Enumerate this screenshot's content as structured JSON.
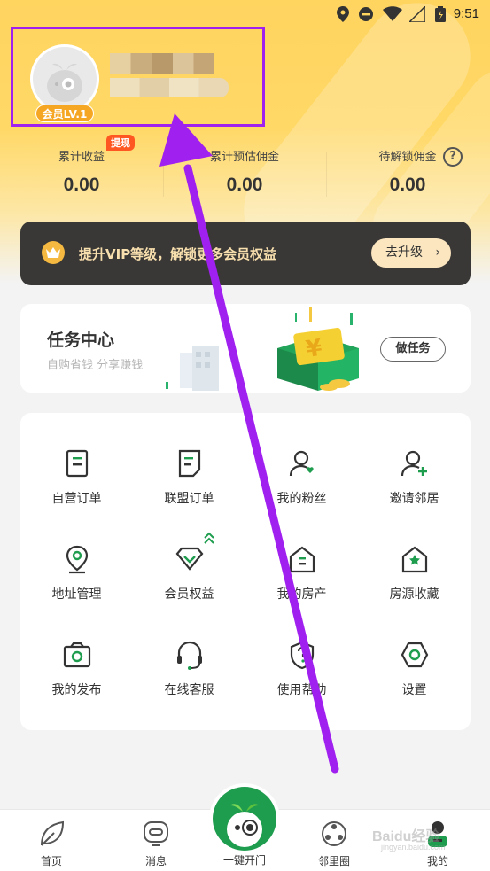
{
  "status_bar": {
    "time": "9:51",
    "icons": [
      "location-icon",
      "dnd-icon",
      "wifi-icon",
      "signal-icon",
      "battery-icon"
    ]
  },
  "profile": {
    "member_level": "会员LV.1"
  },
  "stats": {
    "withdraw_tag": "提现",
    "items": [
      {
        "label": "累计收益",
        "value": "0.00"
      },
      {
        "label": "累计预估佣金",
        "value": "0.00"
      },
      {
        "label": "待解锁佣金",
        "value": "0.00"
      }
    ]
  },
  "vip": {
    "text": "提升VIP等级，解锁更多会员权益",
    "button": "去升级"
  },
  "task": {
    "title": "任务中心",
    "subtitle": "自购省钱 分享赚钱",
    "button": "做任务"
  },
  "grid": {
    "items": [
      {
        "label": "自营订单",
        "icon": "order-icon"
      },
      {
        "label": "联盟订单",
        "icon": "document-icon"
      },
      {
        "label": "我的粉丝",
        "icon": "fans-icon"
      },
      {
        "label": "邀请邻居",
        "icon": "invite-icon"
      },
      {
        "label": "地址管理",
        "icon": "location-pin-icon"
      },
      {
        "label": "会员权益",
        "icon": "diamond-icon"
      },
      {
        "label": "我的房产",
        "icon": "house-icon"
      },
      {
        "label": "房源收藏",
        "icon": "house-star-icon"
      },
      {
        "label": "我的发布",
        "icon": "camera-icon"
      },
      {
        "label": "在线客服",
        "icon": "headset-icon"
      },
      {
        "label": "使用帮助",
        "icon": "help-shield-icon"
      },
      {
        "label": "设置",
        "icon": "settings-icon"
      }
    ]
  },
  "tabs": [
    {
      "label": "首页",
      "icon": "leaf-icon"
    },
    {
      "label": "消息",
      "icon": "message-icon"
    },
    {
      "label": "一键开门",
      "icon": "mascot-icon"
    },
    {
      "label": "邻里圈",
      "icon": "community-icon"
    },
    {
      "label": "我的",
      "icon": "profile-icon"
    }
  ],
  "watermark": {
    "text": "Baidu经验",
    "sub": "jingyan.baidu.com"
  },
  "colors": {
    "accent_green": "#1f9d4f",
    "header_yellow": "#ffd45f",
    "vip_dark": "#3a3836",
    "annotation_purple": "#a020f0"
  }
}
